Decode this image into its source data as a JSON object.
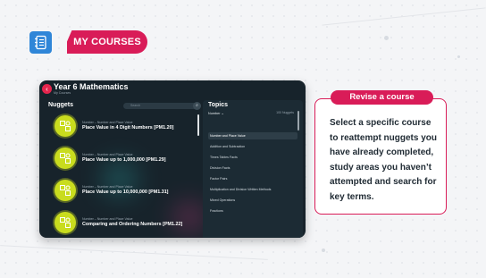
{
  "header": {
    "title": "MY COURSES",
    "icon": "notebook-icon"
  },
  "app": {
    "title": "Year 6 Mathematics",
    "subtitle": "My Courses",
    "back_icon": "back-arrow-icon",
    "nuggets": {
      "heading": "Nuggets",
      "search_placeholder": "Search",
      "items": [
        {
          "category": "Number – Number and Place Value",
          "title": "Place Value in 4 Digit Numbers [PM1.20]"
        },
        {
          "category": "Number – Number and Place Value",
          "title": "Place Value up to 1,000,000 [PM1.29]"
        },
        {
          "category": "Number – Number and Place Value",
          "title": "Place Value up to 10,000,000 [PM1.31]"
        },
        {
          "category": "Number – Number and Place Value",
          "title": "Comparing and Ordering Numbers [PM1.22]"
        }
      ]
    },
    "topics": {
      "heading": "Topics",
      "filter_label": "Number ⌄",
      "count": "100 Nuggets",
      "items": [
        {
          "label": "Number and Place Value",
          "active": true
        },
        {
          "label": "Addition and Subtraction",
          "active": false
        },
        {
          "label": "Times Tables Facts",
          "active": false
        },
        {
          "label": "Division Facts",
          "active": false
        },
        {
          "label": "Factor Pairs",
          "active": false
        },
        {
          "label": "Multiplication and Division Written Methods",
          "active": false
        },
        {
          "label": "Mixed Operations",
          "active": false
        },
        {
          "label": "Fractions",
          "active": false
        }
      ]
    }
  },
  "callout": {
    "title": "Revise a course",
    "text": "Select a specific course to reattempt nuggets you have already completed, study areas you haven’t attempted and search for key terms."
  },
  "colors": {
    "accent": "#d91c58",
    "header_icon": "#2f86d8",
    "app_bg": "#17232b",
    "nugget_icon": "#c9dc1e"
  }
}
